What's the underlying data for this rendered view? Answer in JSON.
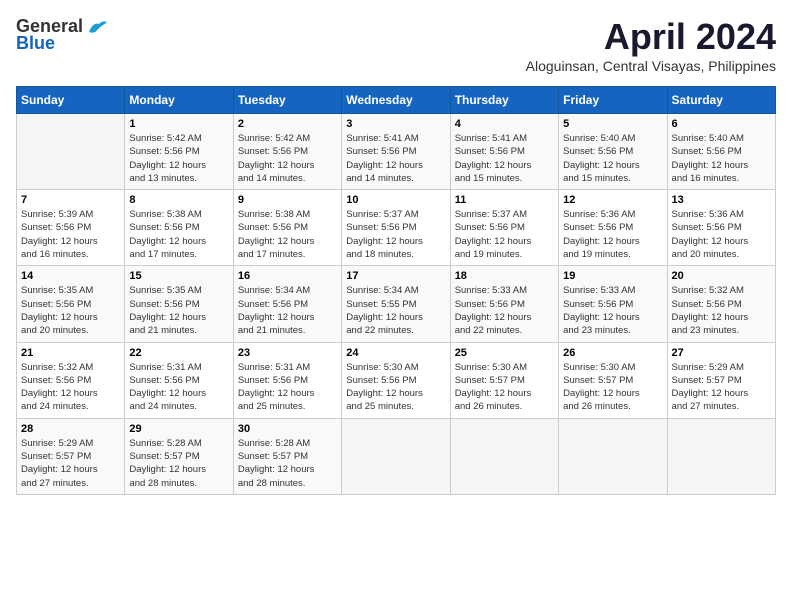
{
  "header": {
    "logo_general": "General",
    "logo_blue": "Blue",
    "month_title": "April 2024",
    "subtitle": "Aloguinsan, Central Visayas, Philippines"
  },
  "weekdays": [
    "Sunday",
    "Monday",
    "Tuesday",
    "Wednesday",
    "Thursday",
    "Friday",
    "Saturday"
  ],
  "weeks": [
    [
      {
        "day": "",
        "info": ""
      },
      {
        "day": "1",
        "info": "Sunrise: 5:42 AM\nSunset: 5:56 PM\nDaylight: 12 hours\nand 13 minutes."
      },
      {
        "day": "2",
        "info": "Sunrise: 5:42 AM\nSunset: 5:56 PM\nDaylight: 12 hours\nand 14 minutes."
      },
      {
        "day": "3",
        "info": "Sunrise: 5:41 AM\nSunset: 5:56 PM\nDaylight: 12 hours\nand 14 minutes."
      },
      {
        "day": "4",
        "info": "Sunrise: 5:41 AM\nSunset: 5:56 PM\nDaylight: 12 hours\nand 15 minutes."
      },
      {
        "day": "5",
        "info": "Sunrise: 5:40 AM\nSunset: 5:56 PM\nDaylight: 12 hours\nand 15 minutes."
      },
      {
        "day": "6",
        "info": "Sunrise: 5:40 AM\nSunset: 5:56 PM\nDaylight: 12 hours\nand 16 minutes."
      }
    ],
    [
      {
        "day": "7",
        "info": "Sunrise: 5:39 AM\nSunset: 5:56 PM\nDaylight: 12 hours\nand 16 minutes."
      },
      {
        "day": "8",
        "info": "Sunrise: 5:38 AM\nSunset: 5:56 PM\nDaylight: 12 hours\nand 17 minutes."
      },
      {
        "day": "9",
        "info": "Sunrise: 5:38 AM\nSunset: 5:56 PM\nDaylight: 12 hours\nand 17 minutes."
      },
      {
        "day": "10",
        "info": "Sunrise: 5:37 AM\nSunset: 5:56 PM\nDaylight: 12 hours\nand 18 minutes."
      },
      {
        "day": "11",
        "info": "Sunrise: 5:37 AM\nSunset: 5:56 PM\nDaylight: 12 hours\nand 19 minutes."
      },
      {
        "day": "12",
        "info": "Sunrise: 5:36 AM\nSunset: 5:56 PM\nDaylight: 12 hours\nand 19 minutes."
      },
      {
        "day": "13",
        "info": "Sunrise: 5:36 AM\nSunset: 5:56 PM\nDaylight: 12 hours\nand 20 minutes."
      }
    ],
    [
      {
        "day": "14",
        "info": "Sunrise: 5:35 AM\nSunset: 5:56 PM\nDaylight: 12 hours\nand 20 minutes."
      },
      {
        "day": "15",
        "info": "Sunrise: 5:35 AM\nSunset: 5:56 PM\nDaylight: 12 hours\nand 21 minutes."
      },
      {
        "day": "16",
        "info": "Sunrise: 5:34 AM\nSunset: 5:56 PM\nDaylight: 12 hours\nand 21 minutes."
      },
      {
        "day": "17",
        "info": "Sunrise: 5:34 AM\nSunset: 5:55 PM\nDaylight: 12 hours\nand 22 minutes."
      },
      {
        "day": "18",
        "info": "Sunrise: 5:33 AM\nSunset: 5:56 PM\nDaylight: 12 hours\nand 22 minutes."
      },
      {
        "day": "19",
        "info": "Sunrise: 5:33 AM\nSunset: 5:56 PM\nDaylight: 12 hours\nand 23 minutes."
      },
      {
        "day": "20",
        "info": "Sunrise: 5:32 AM\nSunset: 5:56 PM\nDaylight: 12 hours\nand 23 minutes."
      }
    ],
    [
      {
        "day": "21",
        "info": "Sunrise: 5:32 AM\nSunset: 5:56 PM\nDaylight: 12 hours\nand 24 minutes."
      },
      {
        "day": "22",
        "info": "Sunrise: 5:31 AM\nSunset: 5:56 PM\nDaylight: 12 hours\nand 24 minutes."
      },
      {
        "day": "23",
        "info": "Sunrise: 5:31 AM\nSunset: 5:56 PM\nDaylight: 12 hours\nand 25 minutes."
      },
      {
        "day": "24",
        "info": "Sunrise: 5:30 AM\nSunset: 5:56 PM\nDaylight: 12 hours\nand 25 minutes."
      },
      {
        "day": "25",
        "info": "Sunrise: 5:30 AM\nSunset: 5:57 PM\nDaylight: 12 hours\nand 26 minutes."
      },
      {
        "day": "26",
        "info": "Sunrise: 5:30 AM\nSunset: 5:57 PM\nDaylight: 12 hours\nand 26 minutes."
      },
      {
        "day": "27",
        "info": "Sunrise: 5:29 AM\nSunset: 5:57 PM\nDaylight: 12 hours\nand 27 minutes."
      }
    ],
    [
      {
        "day": "28",
        "info": "Sunrise: 5:29 AM\nSunset: 5:57 PM\nDaylight: 12 hours\nand 27 minutes."
      },
      {
        "day": "29",
        "info": "Sunrise: 5:28 AM\nSunset: 5:57 PM\nDaylight: 12 hours\nand 28 minutes."
      },
      {
        "day": "30",
        "info": "Sunrise: 5:28 AM\nSunset: 5:57 PM\nDaylight: 12 hours\nand 28 minutes."
      },
      {
        "day": "",
        "info": ""
      },
      {
        "day": "",
        "info": ""
      },
      {
        "day": "",
        "info": ""
      },
      {
        "day": "",
        "info": ""
      }
    ]
  ]
}
